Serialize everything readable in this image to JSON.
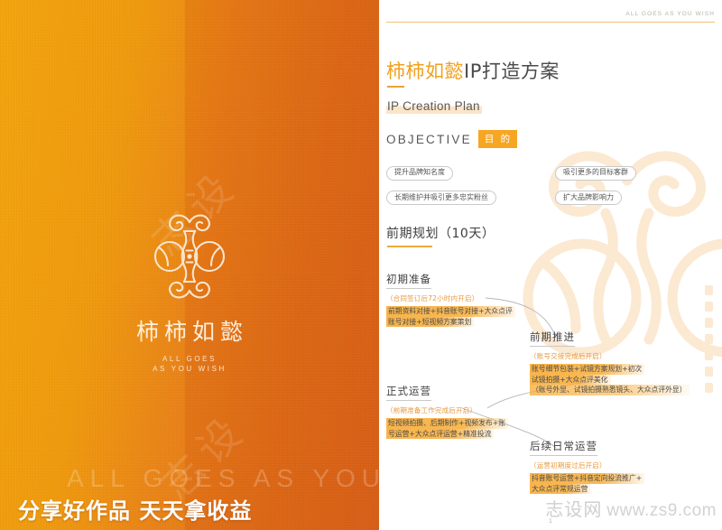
{
  "brand": {
    "logo_cn": "柿柿如懿",
    "logo_en_line1": "ALL GOES",
    "logo_en_line2": "AS YOU WISH",
    "watermark_char": "志设",
    "big_watermark": "ALL GOES AS YOU WISH",
    "header_en": "ALL GOES AS YOU WISH"
  },
  "promo": {
    "text": "分享好作品 天天拿收益"
  },
  "title": {
    "cn_highlight": "柿柿如懿",
    "cn_rest": "IP打造方案",
    "en": "IP Creation Plan"
  },
  "objective": {
    "label_en": "OBJECTIVE",
    "badge_cn": "目 的",
    "tags_left": [
      "提升品牌知名度",
      "长期维护并吸引更多忠实粉丝"
    ],
    "tags_right": [
      "吸引更多的目标客群",
      "扩大品牌影响力"
    ]
  },
  "section": {
    "heading": "前期规划（10天）"
  },
  "timeline": {
    "nodes": [
      {
        "title": "初期准备",
        "condition": "（合同签订后72小时内开启）",
        "lines": [
          "前期资料对接+抖音账号对接+大众点评",
          "账号对接+短视频方案策划"
        ]
      },
      {
        "title": "前期推进",
        "condition": "（账号交接完成后开启）",
        "lines": [
          "账号细节包装+试镜方案规划+初次",
          "试镜拍摄+大众点评美化",
          "（账号外显、试镜拍摄熟悉镜头、大众点评外显）"
        ]
      },
      {
        "title": "正式运营",
        "condition": "（前期准备工作完成后开启）",
        "lines": [
          "短视频拍摄、后期制作+视频发布+账",
          "号运营+大众点评运营+精准投流"
        ]
      },
      {
        "title": "后续日常运营",
        "condition": "（运营初期度过后开启）",
        "lines": [
          "抖音账号运营+抖音定向投流推广+",
          "大众点评常规运营"
        ]
      }
    ]
  },
  "footer": {
    "page_number": "1",
    "site_cn": "志设网",
    "site_url": "www.zs9.com"
  },
  "colors": {
    "orange_start": "#F2A40D",
    "orange_end": "#DD6B1B",
    "accent": "#F6A623",
    "highlight": "#F7AE3C",
    "text_dark": "#3D3D3D"
  }
}
